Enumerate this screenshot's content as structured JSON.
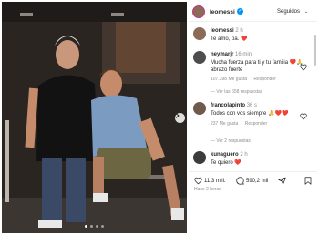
{
  "post": {
    "username": "leomessi",
    "verified_mark": "✓",
    "follow_status": "Seguidos",
    "follow_chevron": "⌄",
    "date": "Hace 2 horas"
  },
  "carousel": {
    "current": 1,
    "total": 4
  },
  "comments": [
    {
      "user": "leomessi",
      "time": "2 h",
      "text": "Te amo, pa. ❤️",
      "likes": "",
      "reply": "",
      "view_replies": ""
    },
    {
      "user": "neymarjr",
      "time": "16 min",
      "text": "Mucha fuerza para ti y tu familia ❤️🙏 abrazo fuerte",
      "likes": "107.398 Me gusta",
      "reply": "Responder",
      "view_replies": "Ver las 658 respuestas"
    },
    {
      "user": "francolapinto",
      "time": "36 s",
      "text": "Todos con vos siempre 🙏❤️❤️",
      "likes": "237 Me gusta",
      "reply": "Responder",
      "view_replies": "Ver 2 respuestas"
    },
    {
      "user": "kunaguero",
      "time": "2 h",
      "text": "Te quiero ❤️",
      "likes": "",
      "reply": "",
      "view_replies": ""
    }
  ],
  "actions": {
    "likes_count": "11,3 mill.",
    "comments_count": "590,2 mil"
  },
  "icons": [
    "verified-icon",
    "heart-icon",
    "comment-icon",
    "share-icon",
    "bookmark-icon",
    "chevron-right-icon"
  ],
  "colors": {
    "like_red": "#ed4956",
    "text": "#262626",
    "muted": "#8e8e8e",
    "verified_blue": "#0095f6"
  }
}
